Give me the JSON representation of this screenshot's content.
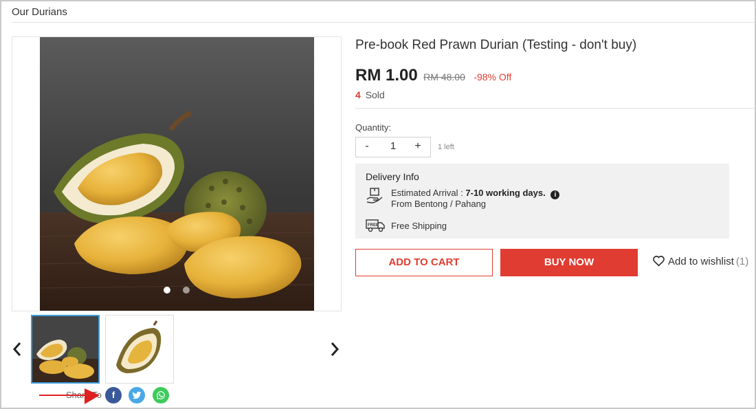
{
  "breadcrumb": {
    "label": "Our Durians"
  },
  "product": {
    "title": "Pre-book Red Prawn Durian (Testing - don't buy)",
    "price": "RM 1.00",
    "original_price": "RM 48.00",
    "discount": "-98% Off",
    "sold_count": "4",
    "sold_label": "Sold"
  },
  "gallery": {
    "dots": 2,
    "active_dot": 1,
    "thumbnails": 2,
    "active_thumbnail": 1,
    "prev_icon": "chevron-left-icon",
    "next_icon": "chevron-right-icon"
  },
  "share": {
    "label": "Share To",
    "networks": [
      "facebook-icon",
      "twitter-icon",
      "whatsapp-icon"
    ]
  },
  "quantity": {
    "label": "Quantity:",
    "minus": "-",
    "value": "1",
    "plus": "+",
    "stock_text": "1 left"
  },
  "delivery": {
    "title": "Delivery Info",
    "arrival_prefix": "Estimated Arrival :",
    "arrival_value": "7-10 working days.",
    "info_glyph": "i",
    "from": "From Bentong / Pahang",
    "shipping": "Free Shipping",
    "truck_badge": "FREE"
  },
  "actions": {
    "add_to_cart": "ADD TO CART",
    "buy_now": "BUY NOW",
    "wishlist_label": "Add to wishlist",
    "wishlist_count": "(1)"
  },
  "colors": {
    "accent": "#e03c31",
    "thumb_active": "#3a9bd9",
    "facebook": "#3b5998",
    "twitter": "#4aa8e8",
    "whatsapp": "#3ecb5c"
  }
}
